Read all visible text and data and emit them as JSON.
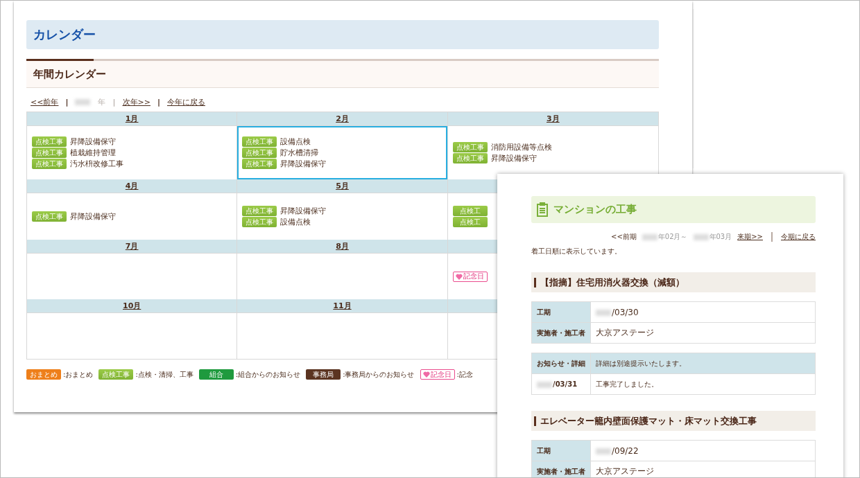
{
  "page_title": "カレンダー",
  "section_title": "年間カレンダー",
  "year_nav": [
    {
      "kind": "link",
      "text": "<<前年"
    },
    {
      "kind": "sep",
      "text": "|"
    },
    {
      "kind": "current",
      "text": "年"
    },
    {
      "kind": "sep-muted",
      "text": "|"
    },
    {
      "kind": "link",
      "text": "次年>>"
    },
    {
      "kind": "sep",
      "text": "|"
    },
    {
      "kind": "link",
      "text": "今年に戻る"
    }
  ],
  "months": [
    {
      "label": "1月",
      "selected": false,
      "items": [
        {
          "kind": "tenken",
          "tag": "点検工事",
          "text": "昇降設備保守"
        },
        {
          "kind": "tenken",
          "tag": "点検工事",
          "text": "植栽維持管理"
        },
        {
          "kind": "tenken",
          "tag": "点検工事",
          "text": "汚水枡改修工事"
        }
      ]
    },
    {
      "label": "2月",
      "selected": true,
      "items": [
        {
          "kind": "tenken",
          "tag": "点検工事",
          "text": "設備点検"
        },
        {
          "kind": "tenken",
          "tag": "点検工事",
          "text": "貯水槽清掃"
        },
        {
          "kind": "tenken",
          "tag": "点検工事",
          "text": "昇降設備保守"
        }
      ]
    },
    {
      "label": "3月",
      "selected": false,
      "items": [
        {
          "kind": "tenken",
          "tag": "点検工事",
          "text": "消防用設備等点検"
        },
        {
          "kind": "tenken",
          "tag": "点検工事",
          "text": "昇降設備保守"
        }
      ]
    },
    {
      "label": "4月",
      "selected": false,
      "items": [
        {
          "kind": "tenken",
          "tag": "点検工事",
          "text": "昇降設備保守"
        }
      ]
    },
    {
      "label": "5月",
      "selected": false,
      "items": [
        {
          "kind": "tenken",
          "tag": "点検工事",
          "text": "昇降設備保守"
        },
        {
          "kind": "tenken",
          "tag": "点検工事",
          "text": "設備点検"
        }
      ]
    },
    {
      "selected": false,
      "items": [
        {
          "kind": "tenken",
          "tag": "点検工"
        },
        {
          "kind": "tenken",
          "tag": "点検工"
        }
      ]
    },
    {
      "label": "7月",
      "selected": false
    },
    {
      "label": "8月",
      "selected": false
    },
    {
      "selected": false,
      "items": [
        {
          "kind": "kinenbi",
          "tag": "記念日"
        }
      ]
    },
    {
      "label": "10月",
      "selected": false
    },
    {
      "label": "11月",
      "selected": false
    },
    {
      "selected": false
    }
  ],
  "legend": [
    {
      "kind": "omatome",
      "tag": "おまとめ",
      "text": ":おまとめ"
    },
    {
      "kind": "tenken",
      "tag": "点検工事",
      "text": ":点検・清掃、工事"
    },
    {
      "kind": "kumiai",
      "tag": "組合",
      "text": ":組合からのお知らせ"
    },
    {
      "kind": "jimu",
      "tag": "事務局",
      "text": ":事務局からのお知らせ"
    },
    {
      "kind": "kinenbi",
      "tag": "記念日",
      "text": ":記念"
    }
  ],
  "works_panel": {
    "title": "マンションの工事",
    "nav": [
      {
        "kind": "plain",
        "text": "<<前期"
      },
      {
        "kind": "period",
        "text": "年02月～"
      },
      {
        "kind": "period",
        "text": "年03月"
      },
      {
        "kind": "link",
        "text": "来期>>"
      },
      {
        "kind": "bar"
      },
      {
        "kind": "link",
        "text": "今期に戻る"
      }
    ],
    "note": "着工日順に表示しています。",
    "works": [
      {
        "title": "【指摘】住宅用消火器交換（減額）",
        "info": [
          {
            "label": "工期",
            "value": "/03/30",
            "redacted_year": true
          },
          {
            "label": "実施者・施工者",
            "value": "大京アステージ",
            "redacted_year": false
          }
        ],
        "notices": {
          "label": "お知らせ・詳細",
          "summary": "詳細は別途提示いたします。",
          "rows": [
            {
              "date": "/03/31",
              "text": "工事完了しました。"
            }
          ]
        }
      },
      {
        "title": "エレベーター籠内壁面保護マット・床マット交換工事",
        "info": [
          {
            "label": "工期",
            "value": "/09/22",
            "redacted_year": true
          },
          {
            "label": "実施者・施工者",
            "value": "大京アステージ",
            "redacted_year": false
          }
        ]
      }
    ]
  }
}
